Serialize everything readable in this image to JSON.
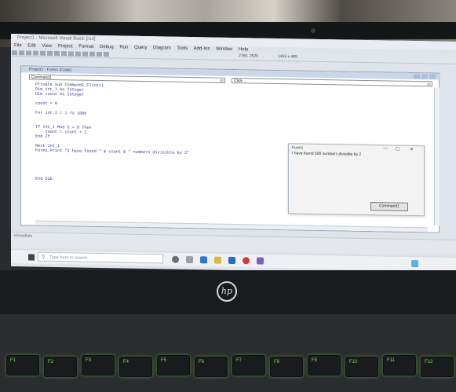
{
  "ide": {
    "title": "Project1 - Microsoft Visual Basic [run]",
    "menus": [
      "File",
      "Edit",
      "View",
      "Project",
      "Format",
      "Debug",
      "Run",
      "Query",
      "Diagram",
      "Tools",
      "Add-Ins",
      "Window",
      "Help"
    ],
    "position": "2760, 2520",
    "size": "1455 x 495",
    "code_window_title": "Project1 - Form1 (Code)",
    "object_combo": "Command1",
    "procedure_combo": "Click",
    "code_lines": [
      "Private Sub Command1_Click()",
      "Dim int_I As Integer",
      "Dim count As Integer",
      "",
      "count = 0",
      "",
      "For int_I = 1 To 1000",
      "",
      "",
      "If int_I Mod 2 = 0 Then",
      "    count = count + 1",
      "End If",
      "",
      "Next int_I",
      "Form1.Print \"I have found \" & count & \" numbers divisible by 2\"",
      "",
      "",
      "",
      "",
      "",
      "End Sub"
    ],
    "immediate_label": "Immediate"
  },
  "form": {
    "title": "Form1",
    "output": "I have found 500 numbers divisible by 2",
    "button_label": "Command1",
    "controls": [
      "—",
      "☐",
      "✕"
    ]
  },
  "taskbar": {
    "search_placeholder": "Type here to search"
  },
  "laptop": {
    "brand": "hp",
    "keys": [
      "F1",
      "F2",
      "F3",
      "F4",
      "F5",
      "F6",
      "F7",
      "F8",
      "F9",
      "F10",
      "F11",
      "F12"
    ]
  }
}
